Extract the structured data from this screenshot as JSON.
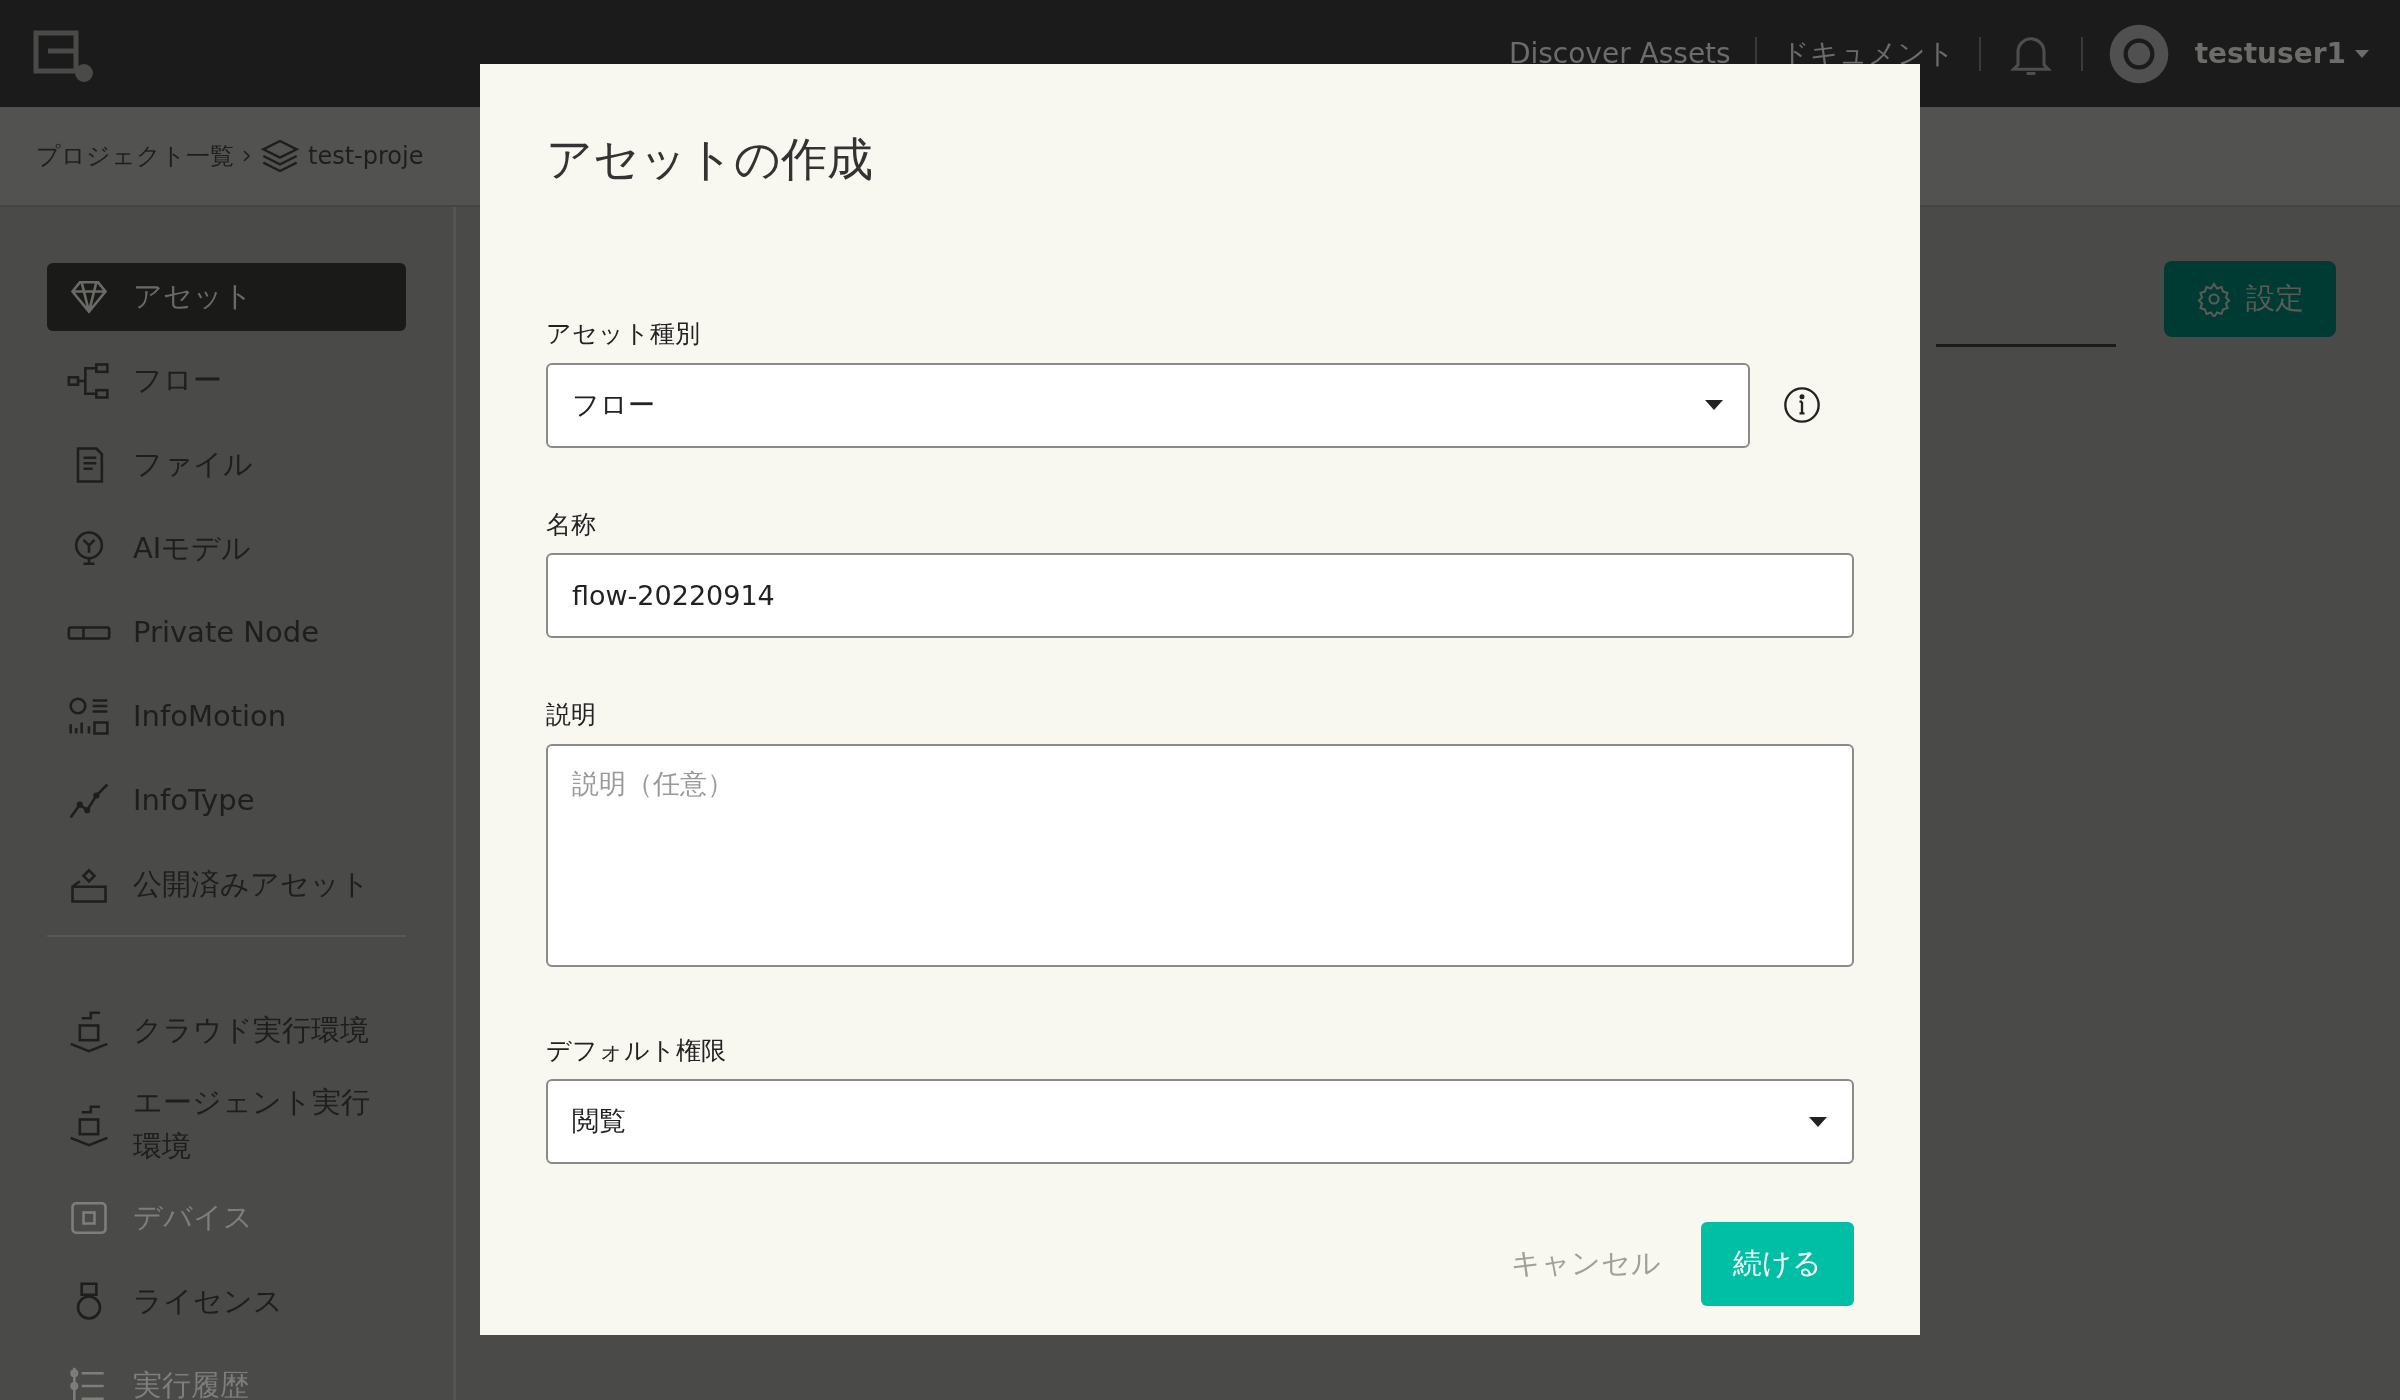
{
  "header": {
    "links": [
      "Discover Assets",
      "ドキュメント"
    ],
    "user": "testuser1"
  },
  "breadcrumb": {
    "items": [
      "プロジェクト一覧",
      "test-proje"
    ]
  },
  "sidebar": {
    "items": [
      {
        "label": "アセット",
        "selected": true,
        "disabled": false
      },
      {
        "label": "フロー",
        "selected": false,
        "disabled": false
      },
      {
        "label": "ファイル",
        "selected": false,
        "disabled": false
      },
      {
        "label": "AIモデル",
        "selected": false,
        "disabled": false
      },
      {
        "label": "Private Node",
        "selected": false,
        "disabled": false
      },
      {
        "label": "InfoMotion",
        "selected": false,
        "disabled": false
      },
      {
        "label": "InfoType",
        "selected": false,
        "disabled": false
      },
      {
        "label": "公開済みアセット",
        "selected": false,
        "disabled": false
      }
    ],
    "items_2": [
      {
        "label": "クラウド実行環境",
        "selected": false,
        "disabled": false
      },
      {
        "label": "エージェント実行環境",
        "selected": false,
        "disabled": false
      },
      {
        "label": "デバイス",
        "selected": false,
        "disabled": true
      },
      {
        "label": "ライセンス",
        "selected": false,
        "disabled": false
      },
      {
        "label": "実行履歴",
        "selected": false,
        "disabled": true
      }
    ]
  },
  "settings_button": "設定",
  "dialog": {
    "title": "アセットの作成",
    "fields": [
      {
        "kind": "select",
        "label": "アセット種別",
        "value": "フロー",
        "info": true
      },
      {
        "kind": "input",
        "label": "名称",
        "value": "flow-20220914"
      },
      {
        "kind": "textarea",
        "label": "説明",
        "placeholder": "説明（任意）"
      },
      {
        "kind": "select",
        "label": "デフォルト権限",
        "value": "閲覧",
        "info": false
      }
    ],
    "buttons": [
      {
        "kind": "secondary",
        "label": "キャンセル"
      },
      {
        "kind": "primary",
        "label": "続ける"
      }
    ]
  }
}
